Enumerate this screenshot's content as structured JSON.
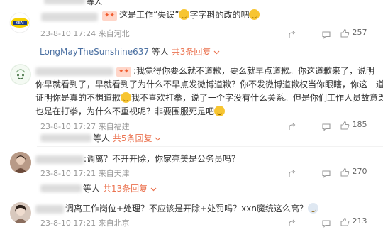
{
  "comment1": {
    "top_partial_text": "等人",
    "text": "这是工作“失误”",
    "text_tail": "字字斟酌改的吧",
    "date": "23-8-10 17:24",
    "location": "来自河北",
    "likes": "257"
  },
  "reply_row1": {
    "username": "LongMayTheSunshine637",
    "suffix": "等人",
    "count_label": "共3条回复"
  },
  "comment2": {
    "line1": ":我觉得你要么就不道歉，要么就早点道歉。你这道歉来了，说明",
    "line2": "你早就看到了，早就看到了为什么不早点发微博道歉？你不发微博道歉权当你眼瞎，你这一道歉",
    "line3a": "证明你是真的不想道歉",
    "line3b": "我不喜欢打拳，说了一个字没有什么关系。但是你们工作人员故意改字",
    "line4": "也是在打拳，为什么不重视呢？非要围服死是吧",
    "date": "23-8-10 17:27",
    "location": "来自福建",
    "likes": "185"
  },
  "reply_row2": {
    "suffix": "等人",
    "count_label": "共5条回复"
  },
  "comment3": {
    "text": ":调离？不开开除，你家亮美是公务员吗？",
    "date": "23-8-10 17:21",
    "location": "来自天津",
    "likes": "270"
  },
  "reply_row3": {
    "suffix": "等人",
    "count_label": "共13条回复"
  },
  "comment4": {
    "text": "调离工作岗位+处理？不应该是开除+处罚吗？xxn魔统这么高？",
    "date": "23-8-10 17:21",
    "location": "来自北京",
    "likes": "213"
  },
  "colors": {
    "link": "#eb7350",
    "username": "#4a6fa1",
    "meta": "#999999"
  }
}
